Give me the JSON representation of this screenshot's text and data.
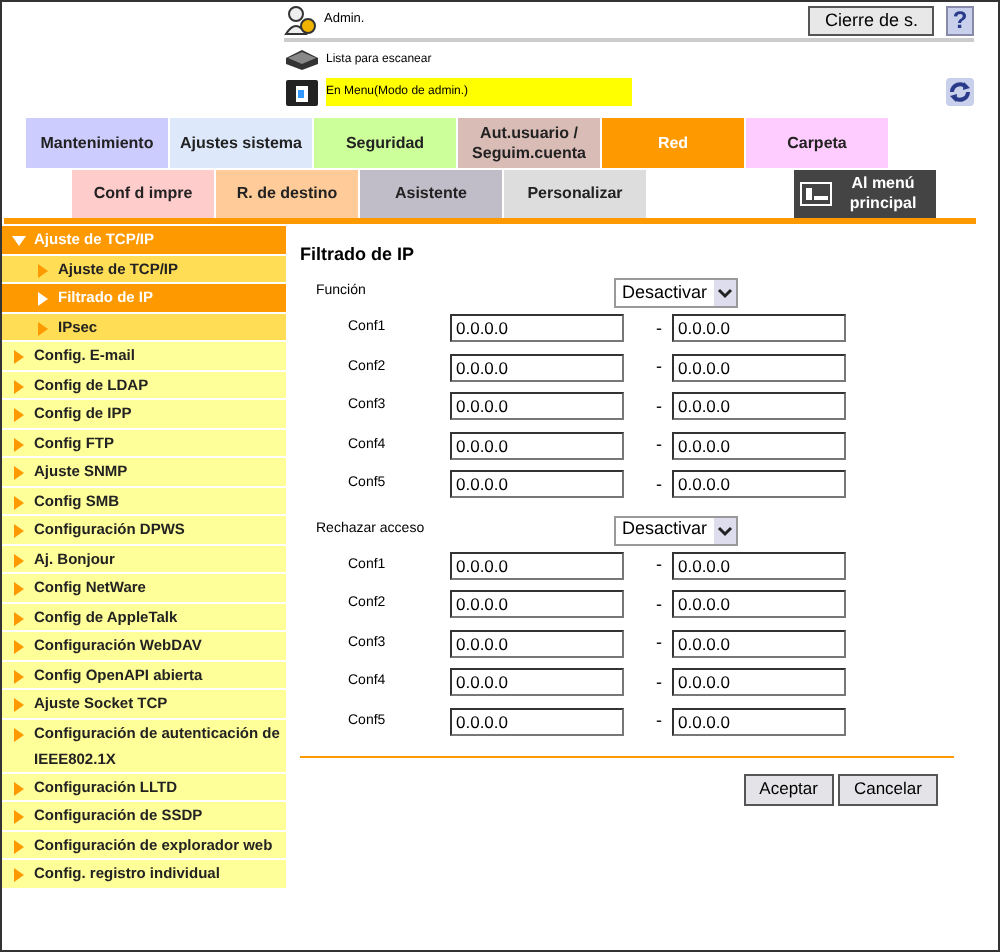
{
  "header": {
    "user": "Admin.",
    "logout_button": "Cierre de s.",
    "help_button": "?",
    "status": [
      {
        "kind": "scanner",
        "text": "Lista para escanear",
        "highlighted": false
      },
      {
        "kind": "printer",
        "text": "En Menu(Modo de admin.)",
        "highlighted": true
      }
    ]
  },
  "tabs": [
    {
      "label": "Mantenimiento",
      "color": "#ccccff",
      "selected": false
    },
    {
      "label": "Ajustes sistema",
      "color": "#dde8fb",
      "selected": false
    },
    {
      "label": "Seguridad",
      "color": "#ccff99",
      "selected": false
    },
    {
      "label": "Aut.usuario / Seguim.cuenta",
      "color": "#d9bcb6",
      "selected": false
    },
    {
      "label": "Red",
      "color": "#ff9900",
      "selected": true
    },
    {
      "label": "Carpeta",
      "color": "#ffccff",
      "selected": false
    }
  ],
  "tabs_row2": [
    {
      "label": "Conf d impre",
      "color": "#ffcccc",
      "selected": false
    },
    {
      "label": "R. de destino",
      "color": "#ffcc99",
      "selected": false
    },
    {
      "label": "Asistente",
      "color": "#c0bcc8",
      "selected": false
    },
    {
      "label": "Personalizar",
      "color": "#dddddd",
      "selected": false
    }
  ],
  "main_menu_button": "Al menú principal",
  "sidebar": {
    "items": [
      {
        "label": "Ajuste de TCP/IP",
        "expanded": true,
        "children": [
          {
            "label": "Ajuste de TCP/IP",
            "selected": false
          },
          {
            "label": "Filtrado de IP",
            "selected": true
          },
          {
            "label": "IPsec",
            "selected": false
          }
        ]
      },
      {
        "label": "Config. E-mail",
        "expanded": false,
        "selected": false
      },
      {
        "label": "Config de LDAP",
        "expanded": false,
        "selected": false
      },
      {
        "label": "Config de IPP",
        "expanded": false,
        "selected": false
      },
      {
        "label": "Config FTP",
        "expanded": false,
        "selected": false
      },
      {
        "label": "Ajuste SNMP",
        "expanded": false,
        "selected": false
      },
      {
        "label": "Config SMB",
        "expanded": false,
        "selected": false
      },
      {
        "label": "Configuración DPWS",
        "expanded": false,
        "selected": false
      },
      {
        "label": "Aj. Bonjour",
        "expanded": false,
        "selected": false
      },
      {
        "label": "Config NetWare",
        "expanded": false,
        "selected": false
      },
      {
        "label": "Config de AppleTalk",
        "expanded": false,
        "selected": false
      },
      {
        "label": "Configuración WebDAV",
        "expanded": false,
        "selected": false
      },
      {
        "label": "Config OpenAPI abierta",
        "expanded": false,
        "selected": false
      },
      {
        "label": "Ajuste Socket TCP",
        "expanded": false,
        "selected": false
      },
      {
        "label": "Configuración de autenticación de IEEE802.1X",
        "expanded": false,
        "selected": false
      },
      {
        "label": "Configuración LLTD",
        "expanded": false,
        "selected": false
      },
      {
        "label": "Configuración de SSDP",
        "expanded": false,
        "selected": false
      },
      {
        "label": "Configuración de explorador web",
        "expanded": false,
        "selected": false
      },
      {
        "label": "Config. registro individual",
        "expanded": false,
        "selected": false
      }
    ]
  },
  "form": {
    "title": "Filtrado de IP",
    "sections": [
      {
        "label": "Función",
        "select": "Desactivar",
        "rows": [
          {
            "label": "Conf1",
            "from": "0.0.0.0",
            "separator": "-",
            "to": "0.0.0.0"
          },
          {
            "label": "Conf2",
            "from": "0.0.0.0",
            "separator": "-",
            "to": "0.0.0.0"
          },
          {
            "label": "Conf3",
            "from": "0.0.0.0",
            "separator": "-",
            "to": "0.0.0.0"
          },
          {
            "label": "Conf4",
            "from": "0.0.0.0",
            "separator": "-",
            "to": "0.0.0.0"
          },
          {
            "label": "Conf5",
            "from": "0.0.0.0",
            "separator": "-",
            "to": "0.0.0.0"
          }
        ]
      },
      {
        "label": "Rechazar acceso",
        "select": "Desactivar",
        "rows": [
          {
            "label": "Conf1",
            "from": "0.0.0.0",
            "separator": "-",
            "to": "0.0.0.0"
          },
          {
            "label": "Conf2",
            "from": "0.0.0.0",
            "separator": "-",
            "to": "0.0.0.0"
          },
          {
            "label": "Conf3",
            "from": "0.0.0.0",
            "separator": "-",
            "to": "0.0.0.0"
          },
          {
            "label": "Conf4",
            "from": "0.0.0.0",
            "separator": "-",
            "to": "0.0.0.0"
          },
          {
            "label": "Conf5",
            "from": "0.0.0.0",
            "separator": "-",
            "to": "0.0.0.0"
          }
        ]
      }
    ],
    "buttons": [
      "Aceptar",
      "Cancelar"
    ]
  }
}
